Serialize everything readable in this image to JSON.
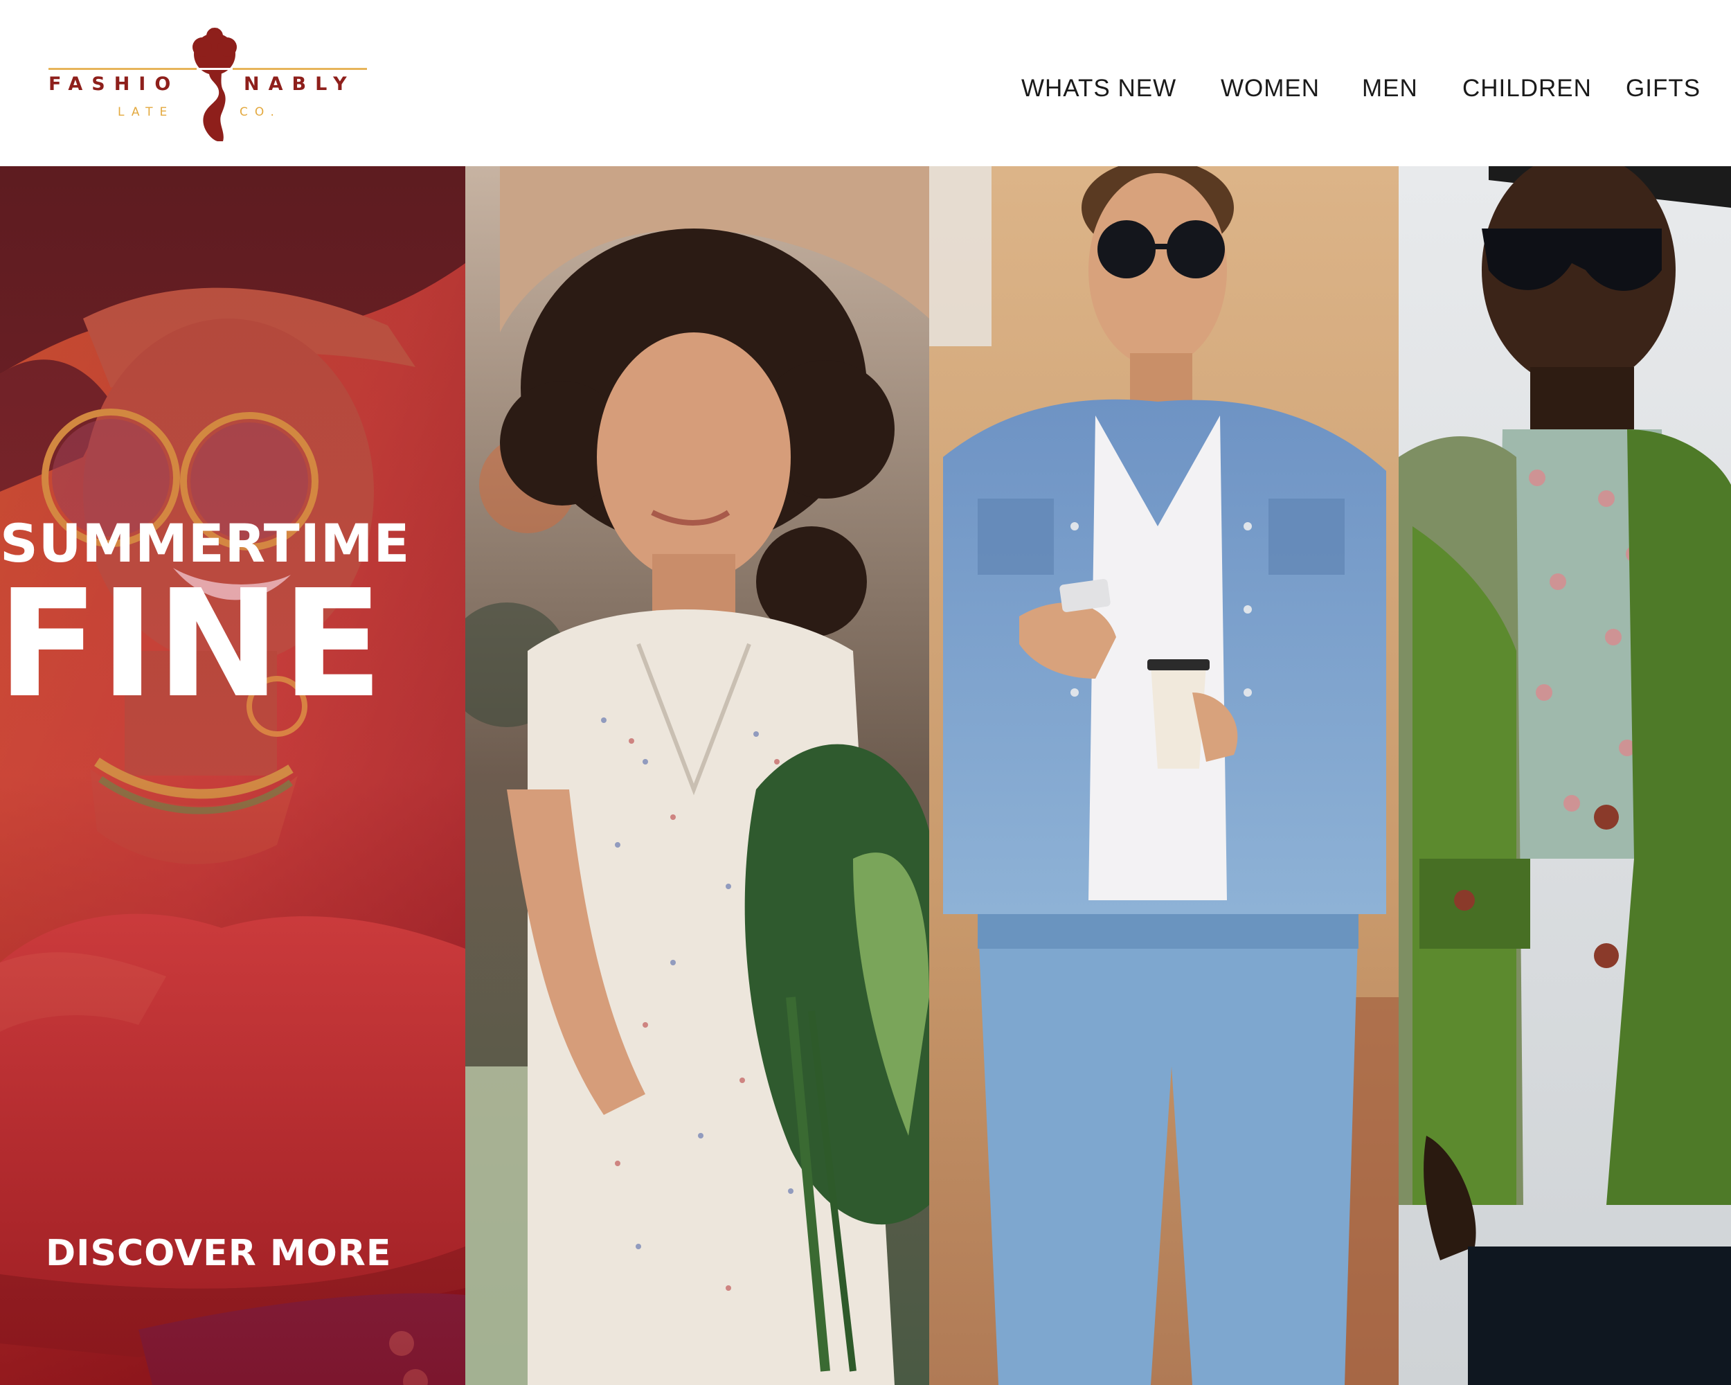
{
  "brand": {
    "name_left": "FASHIO",
    "name_right": "NABLY",
    "sub_left": "LATE",
    "sub_right": "CO.",
    "primary_color": "#8e1f1b",
    "accent_color": "#e7b45a"
  },
  "nav": {
    "items": [
      {
        "label": "WHATS NEW"
      },
      {
        "label": "WOMEN"
      },
      {
        "label": "MEN"
      },
      {
        "label": "CHILDREN"
      },
      {
        "label": "GIFTS"
      }
    ]
  },
  "hero": {
    "headline_line1": "SUMMERTIME",
    "headline_line2": "FINE",
    "cta_label": "DISCOVER MORE",
    "panels": [
      {
        "subject": "woman in red top and sunglasses"
      },
      {
        "subject": "woman with curly hair and hat holding greens"
      },
      {
        "subject": "man in denim shirt with phone and coffee"
      },
      {
        "subject": "man in green jacket and floral shirt with sunglasses"
      }
    ]
  }
}
